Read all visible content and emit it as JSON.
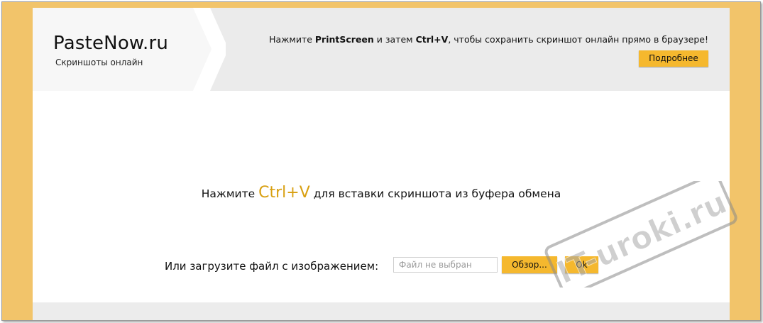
{
  "header": {
    "logo_title": "PasteNow.ru",
    "logo_subtitle": "Скриншоты онлайн",
    "hint_prefix": "Нажмите ",
    "hint_key1": "PrintScreen",
    "hint_middle": " и затем ",
    "hint_key2": "Ctrl+V",
    "hint_suffix": ", чтобы сохранить скриншот онлайн прямо в браузере!",
    "more_button": "Подробнее"
  },
  "main": {
    "paste_prefix": "Нажмите ",
    "paste_key": "Ctrl+V",
    "paste_suffix": " для вставки скриншота из буфера обмена",
    "upload_label": "Или загрузите файл с изображением:",
    "file_placeholder": "Файл не выбран",
    "browse_button": "Обзор...",
    "ok_button": "Ok"
  },
  "watermark": {
    "text": "IT-uroki.ru"
  },
  "colors": {
    "frame": "#f2c46a",
    "accent_button": "#f5b82e",
    "ctrlv_text": "#d89f10",
    "header_bg": "#ebebeb"
  }
}
